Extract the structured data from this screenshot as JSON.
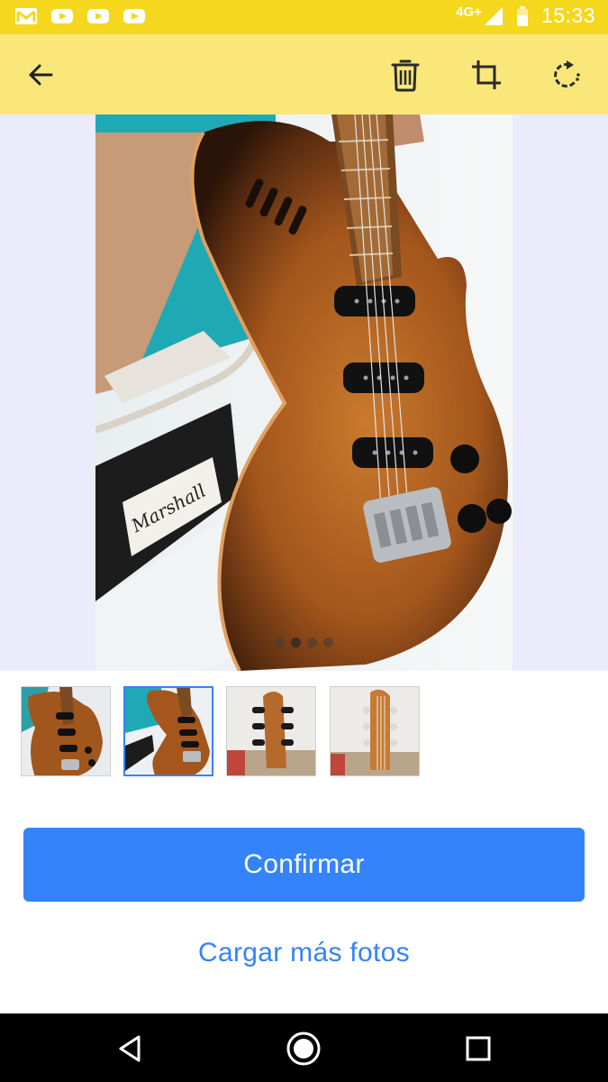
{
  "status_bar": {
    "network": "4G+",
    "time": "15:33",
    "notification_icons": [
      "gmail-icon",
      "youtube-icon",
      "youtube-icon",
      "youtube-icon"
    ]
  },
  "toolbar": {
    "icons": [
      "back-arrow-icon",
      "trash-icon",
      "crop-icon",
      "rotate-icon"
    ]
  },
  "viewer": {
    "image_alt": "guitar photo",
    "photo_count": 4,
    "current_index": 2,
    "logo_on_amp": "Marshall"
  },
  "thumbnails": [
    {
      "alt": "guitar body front",
      "selected": false
    },
    {
      "alt": "guitar body angled",
      "selected": true
    },
    {
      "alt": "guitar headstock back",
      "selected": false
    },
    {
      "alt": "guitar headstock front",
      "selected": false
    }
  ],
  "actions": {
    "confirm_label": "Confirmar",
    "load_more_label": "Cargar más fotos"
  },
  "colors": {
    "status_bar": "#f5d81e",
    "toolbar": "#fae77a",
    "primary": "#3483fa",
    "viewer_bg": "#ecebfb"
  },
  "nav_bar": {
    "icons": [
      "nav-back-icon",
      "nav-home-icon",
      "nav-recents-icon"
    ]
  }
}
